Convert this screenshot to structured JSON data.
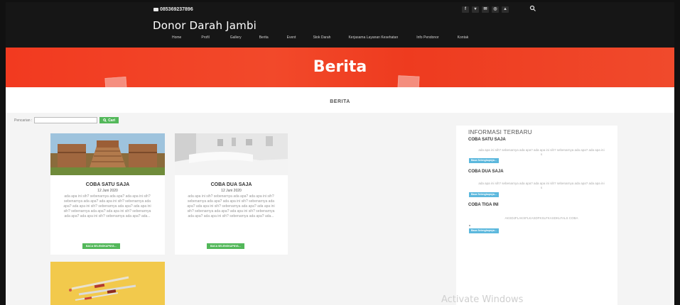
{
  "header": {
    "phone": "085369237896",
    "site_title": "Donor Darah Jambi",
    "social_icons": [
      "facebook-icon",
      "twitter-icon",
      "email-icon",
      "instagram-icon",
      "android-icon"
    ],
    "nav": [
      "Home",
      "Profil",
      "Gallery",
      "Berita",
      "Event",
      "Stok Darah",
      "Kerjasama Layanan Kesehatan",
      "Info Pendonor",
      "Kontak"
    ]
  },
  "banner": {
    "title": "Berita"
  },
  "breadcrumb": {
    "text": "BERITA"
  },
  "search": {
    "label": "Pencarian :",
    "placeholder": "",
    "button": "Cari"
  },
  "posts": [
    {
      "title": "COBA SATU SAJA",
      "date": "12 Juni 2020",
      "excerpt": "ada apa ini sih? sebenarnya ada apa? ada apa ini sih? sebenarnya ada apa? ada apa ini sih? sebenarnya ada apa? ada apa ini sih? sebenarnya ada apa? ada apa ini sih? sebenarnya ada apa? ada apa ini sih? sebenarnya ada apa? ada apa ini sih? sebenarnya ada apa? ada...",
      "button": "BACA SELENGKAPNYA..."
    },
    {
      "title": "COBA DUA SAJA",
      "date": "12 Juni 2020",
      "excerpt": "ada apa ini sih? sebenarnya ada apa? ada apa ini sih? sebenarnya ada apa? ada apa ini sih? sebenarnya ada apa? ada apa ini sih? sebenarnya ada apa? ada apa ini sih? sebenarnya ada apa? ada apa ini sih? sebenarnya ada apa? ada apa ini sih? sebenarnya ada apa? ada...",
      "button": "BACA SELENGKAPNYA..."
    }
  ],
  "sidebar": {
    "heading": "INFORMASI TERBARU",
    "items": [
      {
        "title": "COBA SATU SAJA",
        "text": "ada apa ini sih? sebenarnya ada apa? ada apa ini sih? sebenarnya ada apa? ada apa ini s",
        "button": "Baca Selengkapnya..."
      },
      {
        "title": "COBA DUA SAJA",
        "text": "ada apa ini sih? sebenarnya ada apa? ada apa ini sih? sebenarnya ada apa? ada apa ini s",
        "button": "Baca Selengkapnya..."
      },
      {
        "title": "COBA TIGA INI",
        "text": "AKSDJFLAKSFLKASDFKSLFKASDKLFALS COBA",
        "button": "Baca Selengkapnya..."
      }
    ]
  },
  "watermark": "Activate Windows"
}
